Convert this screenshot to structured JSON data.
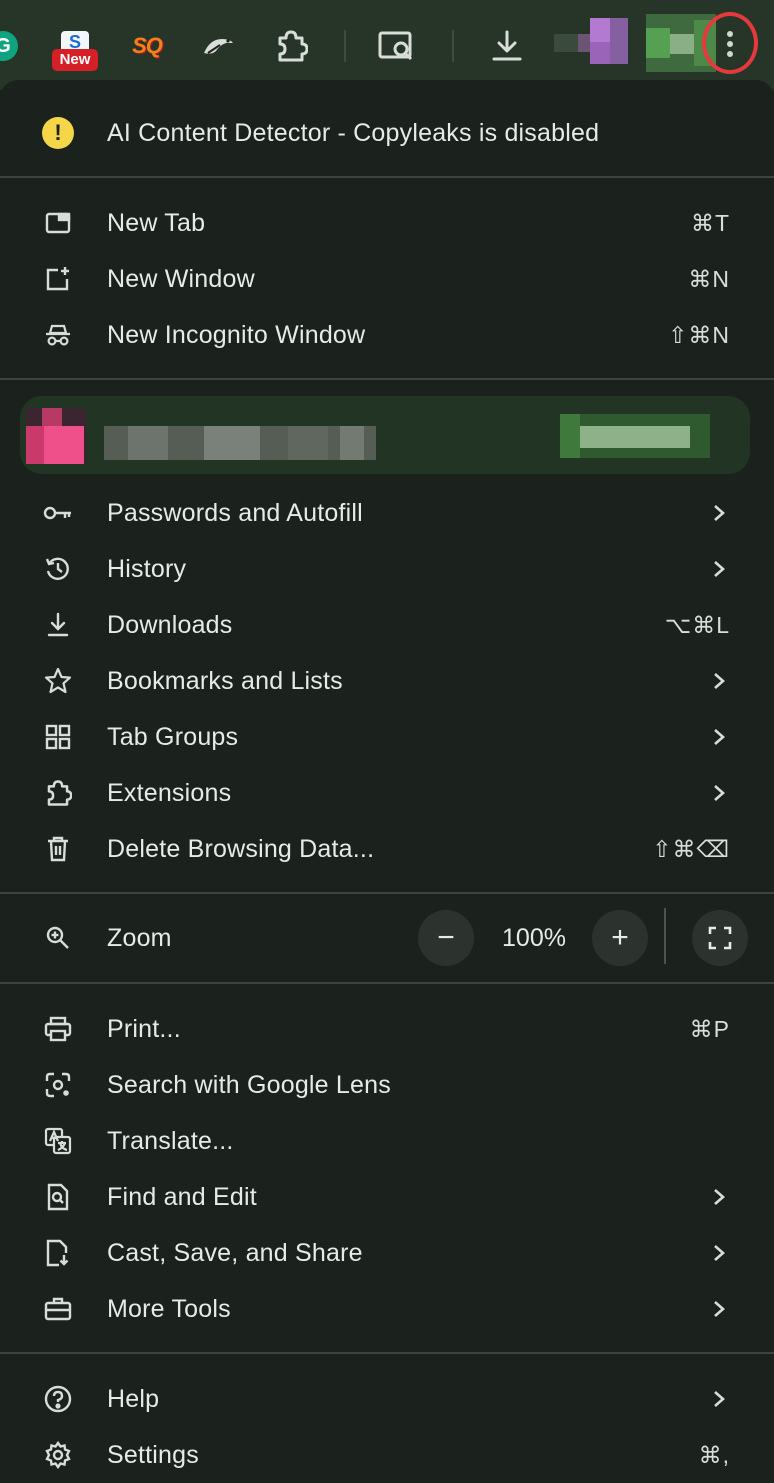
{
  "toolbar": {
    "grammarly_letter": "G",
    "s_tile": "S",
    "s_badge": "New",
    "sq_label": "SQ",
    "icons": [
      "grammarly-icon",
      "extension-s-icon",
      "sq-icon",
      "bird-icon",
      "puzzle-icon",
      "page-search-icon",
      "download-icon",
      "kebab-menu-icon"
    ],
    "highlight_color": "#e53a3d"
  },
  "warning": {
    "icon": "!",
    "text": "AI Content Detector - Copyleaks is disabled"
  },
  "group1": [
    {
      "label": "New Tab",
      "shortcut": "⌘T"
    },
    {
      "label": "New Window",
      "shortcut": "⌘N"
    },
    {
      "label": "New Incognito Window",
      "shortcut": "⇧⌘N"
    }
  ],
  "group2": [
    {
      "label": "Passwords and Autofill"
    },
    {
      "label": "History"
    },
    {
      "label": "Downloads",
      "shortcut": "⌥⌘L"
    },
    {
      "label": "Bookmarks and Lists"
    },
    {
      "label": "Tab Groups"
    },
    {
      "label": "Extensions"
    },
    {
      "label": "Delete Browsing Data...",
      "shortcut": "⇧⌘⌫"
    }
  ],
  "zoom": {
    "label": "Zoom",
    "minus": "−",
    "value": "100%",
    "plus": "+"
  },
  "group3": [
    {
      "label": "Print...",
      "shortcut": "⌘P"
    },
    {
      "label": "Search with Google Lens"
    },
    {
      "label": "Translate..."
    },
    {
      "label": "Find and Edit"
    },
    {
      "label": "Cast, Save, and Share"
    },
    {
      "label": "More Tools"
    }
  ],
  "group4": [
    {
      "label": "Help"
    },
    {
      "label": "Settings",
      "shortcut": "⌘,"
    }
  ],
  "colors": {
    "menu_bg": "#1b211d",
    "toolbar_bg": "#263528",
    "warning": "#f5d648",
    "profile_bg": "#223524"
  }
}
